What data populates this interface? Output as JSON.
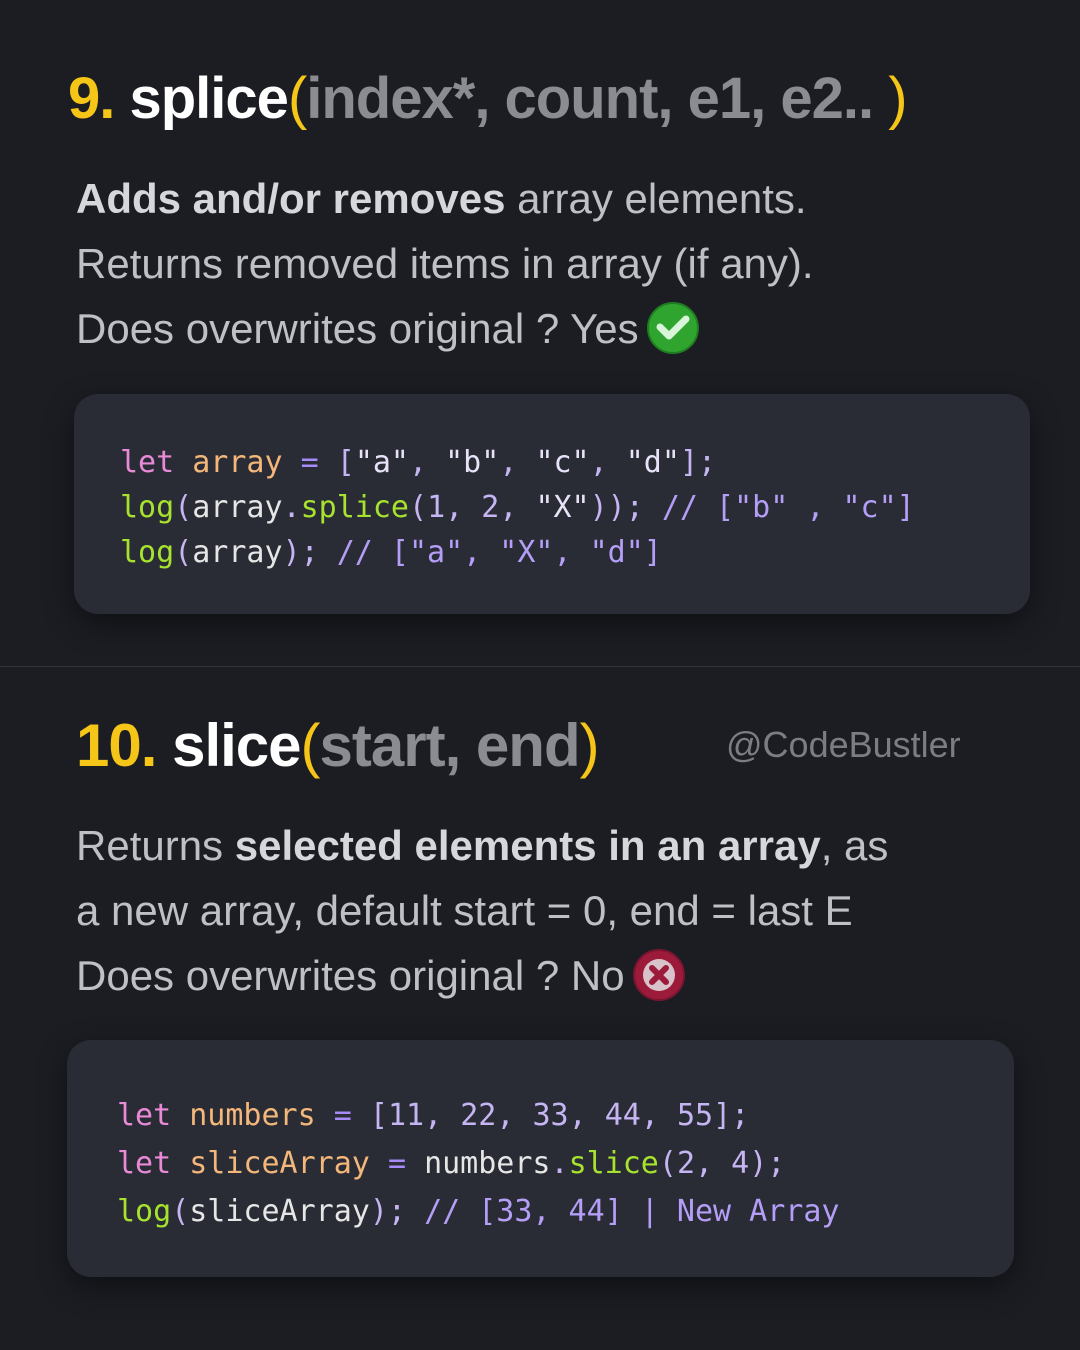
{
  "splice": {
    "number": "9.",
    "name": "splice",
    "open_paren": "(",
    "params": "index*, count, e1, e2.. ",
    "close_paren": ")",
    "desc_bold": "Adds and/or removes",
    "desc_rest": " array elements.",
    "desc_line2": "Returns removed items in array (if any).",
    "desc_line3": "Does overwrites original ? Yes",
    "status_icon": "check-circle-icon",
    "status_color": "#2fa52f",
    "code": {
      "line1": [
        "let",
        " ",
        "array",
        " ",
        "=",
        " ",
        "[",
        "\"a\"",
        ", ",
        "\"b\"",
        ", ",
        "\"c\"",
        ", ",
        "\"d\"",
        "];"
      ],
      "line2": [
        "log",
        "(",
        "array",
        ".",
        "splice",
        "(",
        "1",
        ", ",
        "2",
        ", ",
        "\"X\"",
        "));",
        " ",
        "// [\"b\" , \"c\"]"
      ],
      "line3": [
        "log",
        "(",
        "array",
        ");",
        " ",
        "// [\"a\", \"X\", \"d\"]"
      ]
    }
  },
  "slice": {
    "number": "10.",
    "name": "slice",
    "open_paren": "(",
    "params": "start, end",
    "close_paren": ")",
    "watermark": "@CodeBustler",
    "desc_pre": "Returns ",
    "desc_bold": "selected elements in an array",
    "desc_post": ", as",
    "desc_line2": "a new array, default start = 0, end = last E",
    "desc_line3": "Does overwrites original ? No",
    "status_icon": "x-circle-icon",
    "status_color": "#9c1a3a",
    "code": {
      "line1": [
        "let",
        " ",
        "numbers",
        " ",
        "=",
        " ",
        "[",
        "11",
        ", ",
        "22",
        ", ",
        "33",
        ", ",
        "44",
        ", ",
        "55",
        "];"
      ],
      "line2": [
        "let",
        " ",
        "sliceArray",
        " ",
        "=",
        " ",
        "numbers",
        ".",
        "slice",
        "(",
        "2",
        ", ",
        "4",
        ");"
      ],
      "line3": [
        "log",
        "(",
        "sliceArray",
        ");",
        " ",
        "// [33, 44] | New Array"
      ]
    }
  }
}
